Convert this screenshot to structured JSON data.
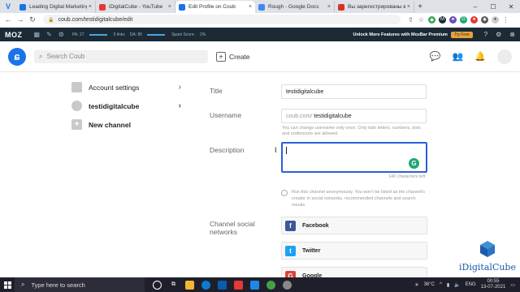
{
  "browser": {
    "tabs": [
      {
        "label": "Leading Digital Marketing",
        "color": "#1a73e8",
        "active": false
      },
      {
        "label": "iDigitalCube - YouTube",
        "color": "#e53935",
        "active": false
      },
      {
        "label": "Edit Profile on Coub",
        "color": "#1a73e8",
        "active": true
      },
      {
        "label": "Rough - Google Docs",
        "color": "#4285f4",
        "active": false
      },
      {
        "label": "Вы зарегистрированы в с",
        "color": "#d93025",
        "active": false
      }
    ],
    "new_tab": "+",
    "url": "coub.com/testidigitalcube/edit"
  },
  "mozbar": {
    "logo": "MOZ",
    "pa": "PA: 27",
    "links": "0 links",
    "da": "DA: 85",
    "spam": "Spam Score:",
    "spam_value": "2%",
    "promo": "Unlock More Features with MozBar Premium",
    "button": "Try Free"
  },
  "coub_header": {
    "search_placeholder": "Search Coub",
    "create_label": "Create"
  },
  "left_menu": [
    {
      "label": "Account settings"
    },
    {
      "label": "testidigitalcube"
    },
    {
      "label": "New channel"
    }
  ],
  "form": {
    "title_label": "Title",
    "title_value": "testidigitalcube",
    "username_label": "Username",
    "username_prefix": "coub.com/",
    "username_value": "testidigitalcube",
    "username_hint": "You can change username only once. Only latin letters, numbers, dots and underscore are allowed.",
    "description_label": "Description",
    "description_value": "",
    "counter": "140 characters left",
    "anon_text": "Run this channel anonymously. You won't be listed as the channel's creator in social networks, recommended channels and search results",
    "social_label": "Channel social networks",
    "social": [
      {
        "label": "Facebook",
        "color": "#3b5998",
        "icon": "f"
      },
      {
        "label": "Twitter",
        "color": "#1da1f2",
        "icon": "t"
      },
      {
        "label": "Google",
        "color": "#db4437",
        "icon": "G"
      }
    ]
  },
  "watermark": {
    "brand": "iDigitalCube"
  },
  "taskbar": {
    "search_placeholder": "Type here to search",
    "temperature": "36°C",
    "language": "ENG",
    "time": "00:55",
    "date": "13-07-2021"
  }
}
